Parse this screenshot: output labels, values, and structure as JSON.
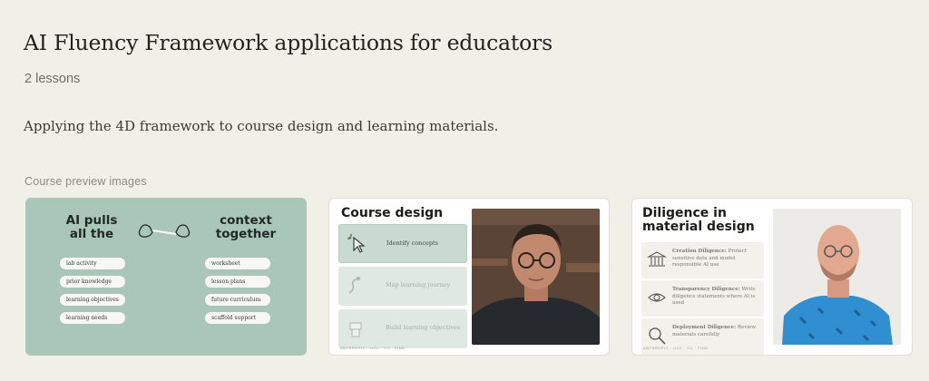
{
  "page": {
    "title": "AI Fluency Framework applications for educators",
    "lessons": "2 lessons",
    "description": "Applying the 4D framework to course design and learning materials.",
    "preview_label": "Course preview images"
  },
  "card1": {
    "left_heading": "AI pulls all the",
    "right_heading": "context together",
    "left_pills": [
      "lab activity",
      "prior knowledge",
      "learning objectives",
      "learning needs"
    ],
    "right_pills": [
      "worksheet",
      "lesson plans",
      "future curriculum",
      "scaffold support"
    ]
  },
  "card2": {
    "title": "Course design",
    "steps": [
      "Identify concepts",
      "Map learning journey",
      "Build learning objectives"
    ],
    "footer": "ANTHROPIC · UCC · CC · FIND"
  },
  "card3": {
    "title": "Diligence in material design",
    "items": [
      {
        "label": "Creation Diligence:",
        "text": "Protect sensitive data and model responsible AI use"
      },
      {
        "label": "Transparency Diligence:",
        "text": "Write diligence statements where AI is used"
      },
      {
        "label": "Deployment Diligence:",
        "text": "Review materials carefully"
      }
    ],
    "footer": "ANTHROPIC · UCC · CC · FIND"
  },
  "icons": [
    "hands-icon",
    "cursor-icon",
    "path-icon",
    "building-blocks-icon",
    "bank-icon",
    "eye-icon",
    "magnifier-icon"
  ]
}
